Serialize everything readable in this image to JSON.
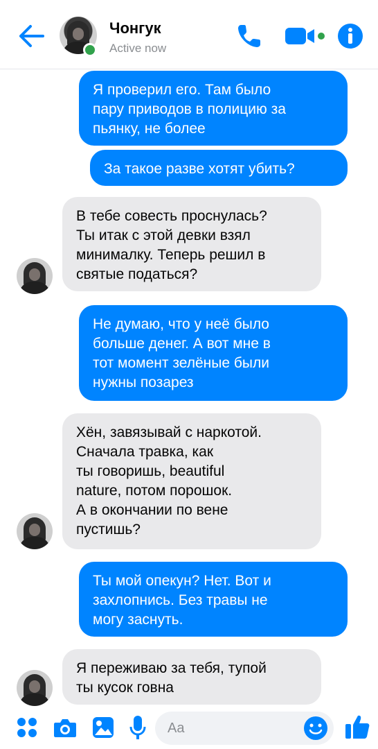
{
  "header": {
    "contact_name": "Чонгук",
    "status": "Active now",
    "accent_color": "#0084ff",
    "active_color": "#31a24c"
  },
  "messages": [
    {
      "direction": "outgoing",
      "text": "Я проверил его. Там было\nпару приводов в полицию за\nпьянку, не более"
    },
    {
      "direction": "outgoing",
      "text": "За такое разве хотят убить?"
    },
    {
      "direction": "incoming",
      "text": "В тебе совесть проснулась?\nТы итак с этой девки взял\nминималку. Теперь решил в\nсвятые податься?"
    },
    {
      "direction": "outgoing",
      "text": "Не думаю, что у неё было\nбольше денег. А вот мне в\nтот момент зелёные были\nнужны позарез"
    },
    {
      "direction": "incoming",
      "text": "Хён, завязывай с наркотой.\nСначала травка, как\nты говоришь, beautiful\nnature, потом порошок.\nА в окончании по вене\nпустишь?"
    },
    {
      "direction": "outgoing",
      "text": "Ты мой опекун? Нет. Вот и\nзахлопнись. Без травы не\nмогу заснуть."
    },
    {
      "direction": "incoming",
      "text": "Я переживаю за тебя, тупой\nты кусок говна"
    }
  ],
  "composer": {
    "placeholder": "Aa",
    "icons": [
      "apps-icon",
      "camera-icon",
      "gallery-icon",
      "microphone-icon",
      "emoji-icon",
      "like-icon"
    ]
  }
}
